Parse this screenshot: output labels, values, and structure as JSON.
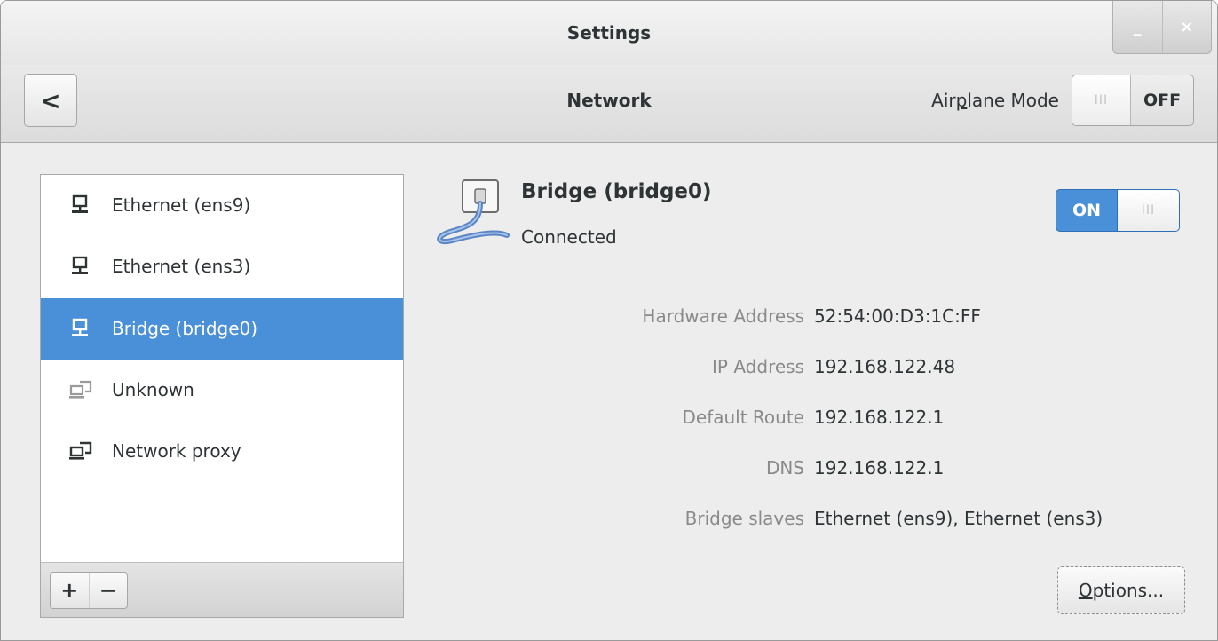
{
  "window": {
    "title": "Settings",
    "minimize_glyph": "_",
    "close_glyph": "×"
  },
  "header": {
    "back_glyph": "<",
    "title": "Network",
    "airplane_label_pre": "Air",
    "airplane_label_mnemonic": "p",
    "airplane_label_post": "lane Mode",
    "airplane_switch_knob": "III",
    "airplane_switch_state": "OFF"
  },
  "sidebar": {
    "items": [
      {
        "label": "Ethernet (ens9)",
        "icon": "wired-network-icon",
        "selected": false
      },
      {
        "label": "Ethernet (ens3)",
        "icon": "wired-network-icon",
        "selected": false
      },
      {
        "label": "Bridge (bridge0)",
        "icon": "wired-network-icon",
        "selected": true
      },
      {
        "label": "Unknown",
        "icon": "network-unknown-icon",
        "selected": false
      },
      {
        "label": "Network proxy",
        "icon": "network-proxy-icon",
        "selected": false
      }
    ],
    "add_glyph": "+",
    "remove_glyph": "−"
  },
  "device": {
    "name": "Bridge (bridge0)",
    "status": "Connected",
    "switch_state": "ON",
    "switch_knob": "III",
    "details": [
      {
        "label": "Hardware Address",
        "value": "52:54:00:D3:1C:FF"
      },
      {
        "label": "IP Address",
        "value": "192.168.122.48"
      },
      {
        "label": "Default Route",
        "value": "192.168.122.1"
      },
      {
        "label": "DNS",
        "value": "192.168.122.1"
      },
      {
        "label": "Bridge slaves",
        "value": "Ethernet (ens9), Ethernet (ens3)"
      }
    ],
    "options_mnemonic": "O",
    "options_rest": "ptions..."
  },
  "colors": {
    "selection": "#4a90d9",
    "switch_on": "#4a90d9",
    "label_gray": "#8a8a8a",
    "text": "#2e3436"
  }
}
